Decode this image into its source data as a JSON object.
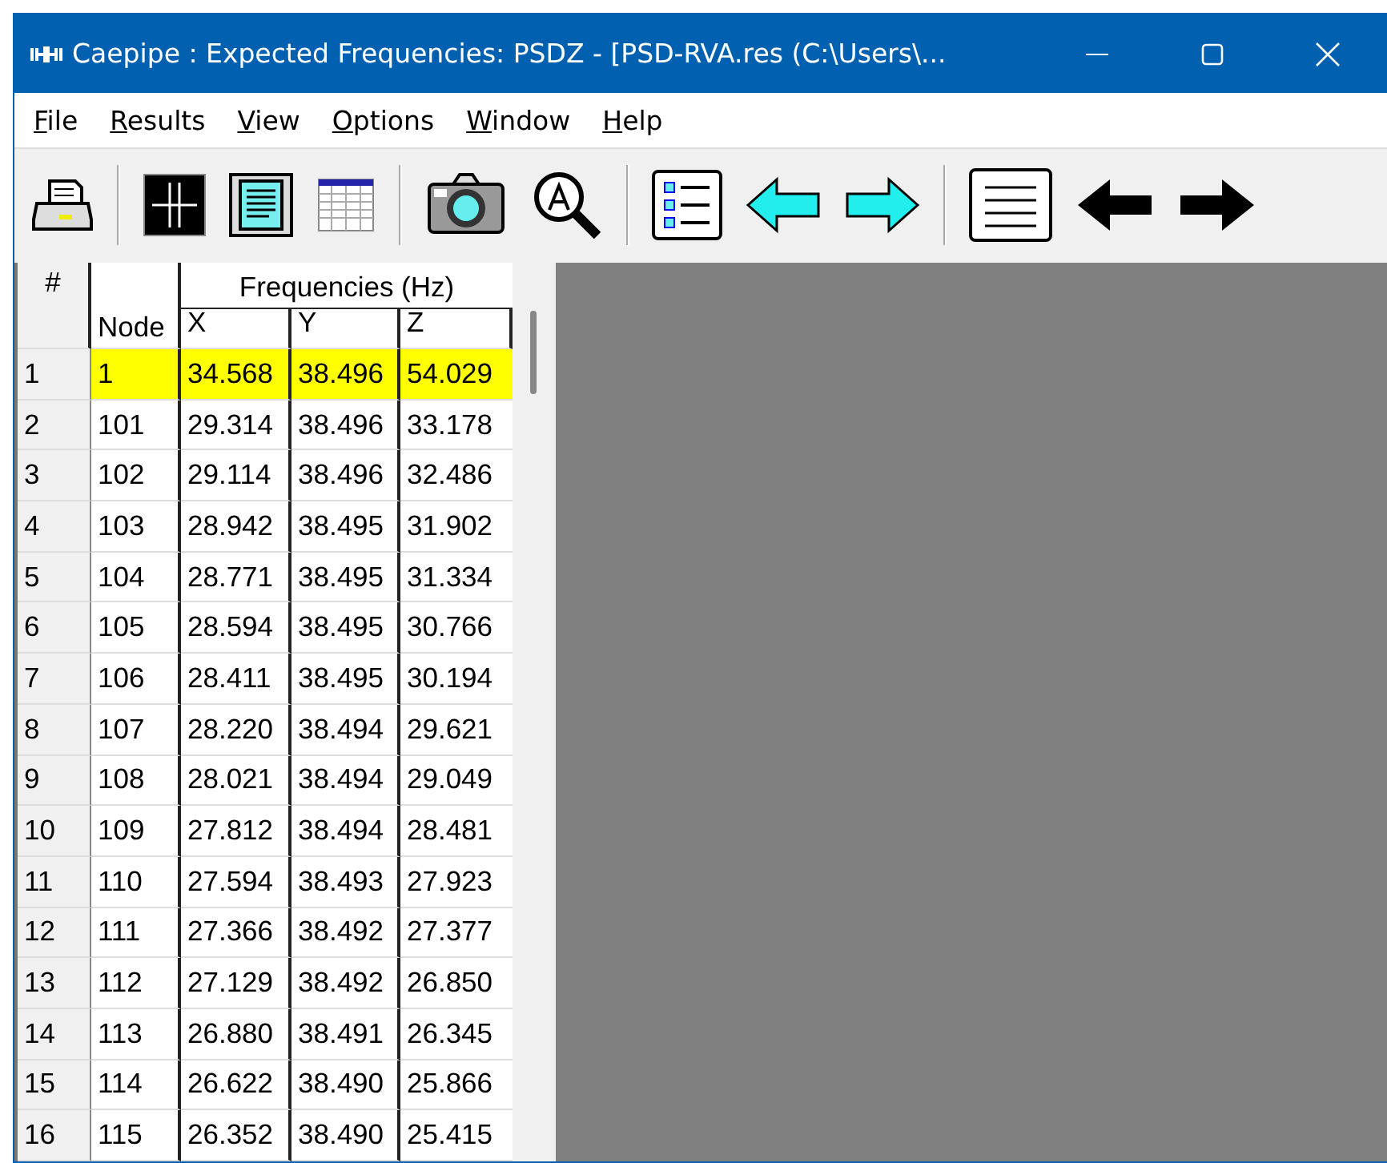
{
  "window": {
    "title": "Caepipe : Expected Frequencies: PSDZ -  [PSD-RVA.res (C:\\Users\\..."
  },
  "menu": [
    {
      "label": "File"
    },
    {
      "label": "Results"
    },
    {
      "label": "View"
    },
    {
      "label": "Options"
    },
    {
      "label": "Window"
    },
    {
      "label": "Help"
    }
  ],
  "toolbar": [
    {
      "kind": "printer"
    },
    {
      "kind": "separator"
    },
    {
      "kind": "crosshair"
    },
    {
      "kind": "document"
    },
    {
      "kind": "table"
    },
    {
      "kind": "separator"
    },
    {
      "kind": "camera"
    },
    {
      "kind": "zoom"
    },
    {
      "kind": "separator"
    },
    {
      "kind": "list"
    },
    {
      "kind": "cyan-left"
    },
    {
      "kind": "cyan-right"
    },
    {
      "kind": "separator"
    },
    {
      "kind": "text"
    },
    {
      "kind": "black-left"
    },
    {
      "kind": "black-right"
    }
  ],
  "table": {
    "index_header": "#",
    "node_header": "Node",
    "group_header": "Frequencies (Hz)",
    "columns": [
      "X",
      "Y",
      "Z"
    ],
    "rows": [
      {
        "index": "1",
        "node": "1",
        "values": [
          "34.568",
          "38.496",
          "54.029"
        ],
        "selected": true
      },
      {
        "index": "2",
        "node": "101",
        "values": [
          "29.314",
          "38.496",
          "33.178"
        ],
        "selected": false
      },
      {
        "index": "3",
        "node": "102",
        "values": [
          "29.114",
          "38.496",
          "32.486"
        ],
        "selected": false
      },
      {
        "index": "4",
        "node": "103",
        "values": [
          "28.942",
          "38.495",
          "31.902"
        ],
        "selected": false
      },
      {
        "index": "5",
        "node": "104",
        "values": [
          "28.771",
          "38.495",
          "31.334"
        ],
        "selected": false
      },
      {
        "index": "6",
        "node": "105",
        "values": [
          "28.594",
          "38.495",
          "30.766"
        ],
        "selected": false
      },
      {
        "index": "7",
        "node": "106",
        "values": [
          "28.411",
          "38.495",
          "30.194"
        ],
        "selected": false
      },
      {
        "index": "8",
        "node": "107",
        "values": [
          "28.220",
          "38.494",
          "29.621"
        ],
        "selected": false
      },
      {
        "index": "9",
        "node": "108",
        "values": [
          "28.021",
          "38.494",
          "29.049"
        ],
        "selected": false
      },
      {
        "index": "10",
        "node": "109",
        "values": [
          "27.812",
          "38.494",
          "28.481"
        ],
        "selected": false
      },
      {
        "index": "11",
        "node": "110",
        "values": [
          "27.594",
          "38.493",
          "27.923"
        ],
        "selected": false
      },
      {
        "index": "12",
        "node": "111",
        "values": [
          "27.366",
          "38.492",
          "27.377"
        ],
        "selected": false
      },
      {
        "index": "13",
        "node": "112",
        "values": [
          "27.129",
          "38.492",
          "26.850"
        ],
        "selected": false
      },
      {
        "index": "14",
        "node": "113",
        "values": [
          "26.880",
          "38.491",
          "26.345"
        ],
        "selected": false
      },
      {
        "index": "15",
        "node": "114",
        "values": [
          "26.622",
          "38.490",
          "25.866"
        ],
        "selected": false
      },
      {
        "index": "16",
        "node": "115",
        "values": [
          "26.352",
          "38.490",
          "25.415"
        ],
        "selected": false
      }
    ]
  }
}
